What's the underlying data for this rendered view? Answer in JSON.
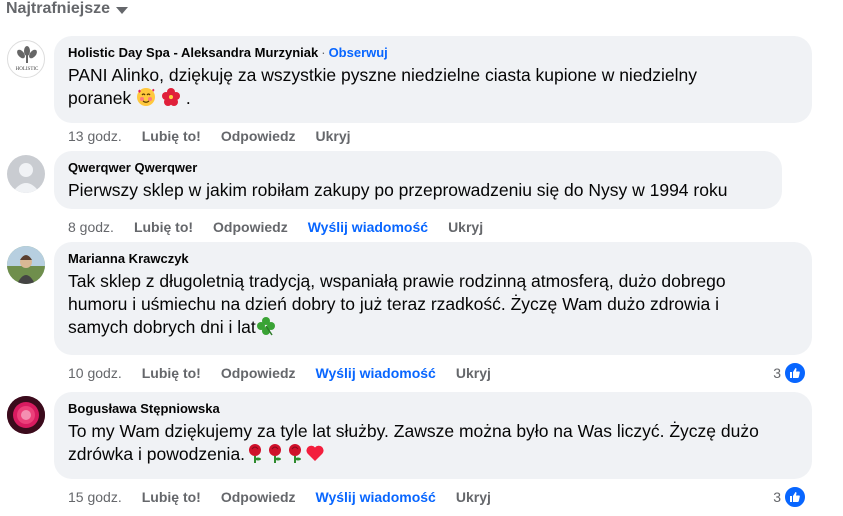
{
  "sort": {
    "label": "Najtrafniejsze"
  },
  "comments": [
    {
      "author": "Holistic Day Spa - Aleksandra Murzyniak",
      "dot": "·",
      "follow": "Obserwuj",
      "text_lines": [
        "PANI Alinko, dziękuję za wszystkie pyszne niedzielne ciasta kupione w niedzielny",
        "poranek",
        "."
      ],
      "emojis": [
        "smiling-face-with-hearts",
        "hibiscus"
      ],
      "time": "13 godz.",
      "like": "Lubię to!",
      "reply": "Odpowiedz",
      "hide": "Ukryj",
      "avatar_text": "HOLISTIC"
    },
    {
      "author": "Qwerqwer Qwerqwer",
      "text": "Pierwszy sklep w jakim robiłam zakupy po przeprowadzeniu się do Nysy w 1994 roku",
      "time": "8 godz.",
      "like": "Lubię to!",
      "reply": "Odpowiedz",
      "message": "Wyślij wiadomość",
      "hide": "Ukryj"
    },
    {
      "author": "Marianna Krawczyk",
      "text_lines": [
        "Tak sklep z długoletnią tradycją, wspaniałą prawie rodzinną atmosferą, dużo dobrego",
        "humoru i uśmiechu na dzień dobry to już teraz rzadkość. Życzę Wam dużo zdrowia i",
        "samych dobrych dni i lat"
      ],
      "emojis": [
        "four-leaf-clover"
      ],
      "time": "10 godz.",
      "like": "Lubię to!",
      "reply": "Odpowiedz",
      "message": "Wyślij wiadomość",
      "hide": "Ukryj",
      "reaction_count": "3"
    },
    {
      "author": "Bogusława Stępniowska",
      "text_lines": [
        "To my Wam dziękujemy za tyle lat służby. Zawsze można było na Was liczyć. Życzę dużo",
        "zdrówka i powodzenia."
      ],
      "emojis": [
        "rose",
        "rose",
        "rose",
        "red-heart"
      ],
      "time": "15 godz.",
      "like": "Lubię to!",
      "reply": "Odpowiedz",
      "message": "Wyślij wiadomość",
      "hide": "Ukryj",
      "reaction_count": "3"
    }
  ],
  "colors": {
    "bubble": "#f0f2f5",
    "secondary_text": "#65676b",
    "accent": "#0866ff"
  }
}
